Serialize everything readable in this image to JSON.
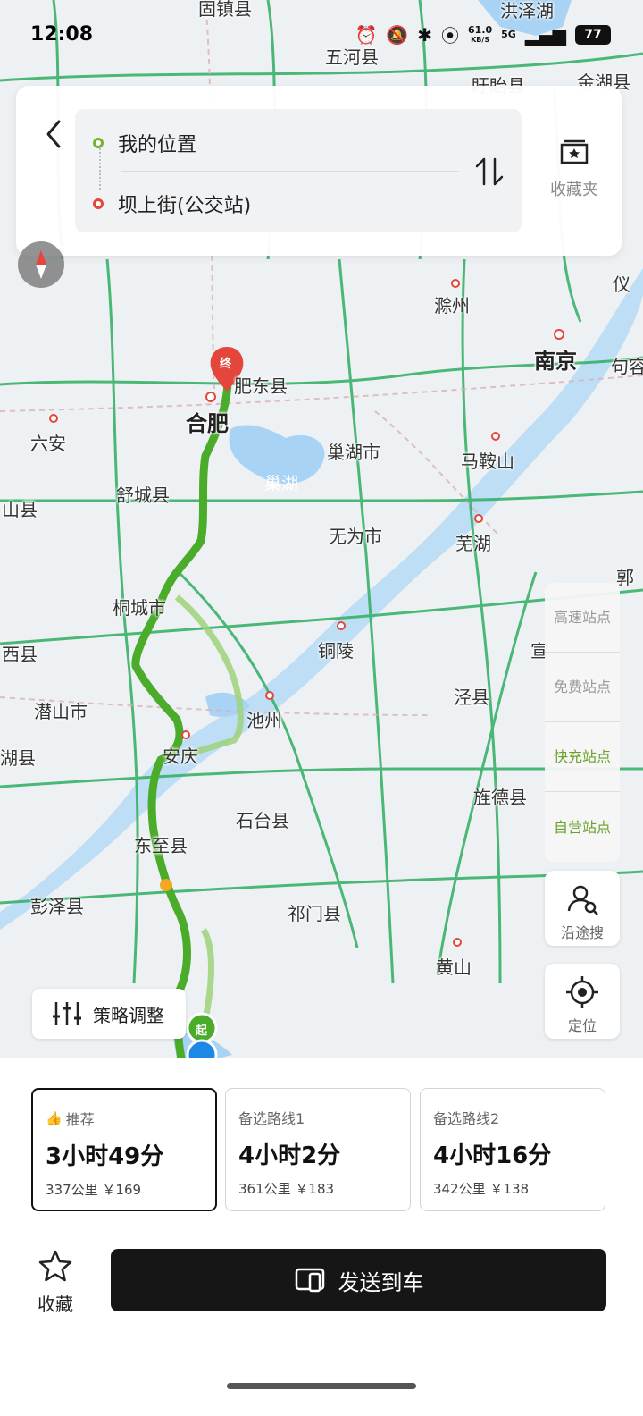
{
  "status": {
    "time": "12:08",
    "net_speed": "61.0",
    "net_unit": "KB/S",
    "net_type": "5G",
    "battery": "77"
  },
  "route_search": {
    "origin": "我的位置",
    "destination": "坝上街(公交站)",
    "favorites_label": "收藏夹"
  },
  "map": {
    "labels": {
      "gu_zhen": "固镇县",
      "hongze_lake": "洪泽湖",
      "wuhe": "五河县",
      "xuyi": "盱眙县",
      "jinhu": "金湖县",
      "chuzhou": "滁州",
      "nanjing": "南京",
      "feidong": "肥东县",
      "hefei": "合肥",
      "liuan": "六安",
      "chaohu_city": "巢湖市",
      "chaohu_lake": "巢湖",
      "maanshan": "马鞍山",
      "shucheng": "舒城县",
      "wuwei": "无为市",
      "wuhu": "芜湖",
      "tongcheng": "桐城市",
      "tongling": "铜陵",
      "qianshan": "潜山市",
      "chizhou": "池州",
      "anqing": "安庆",
      "jingxian": "泾县",
      "jingde": "旌德县",
      "shitai": "石台县",
      "dongzhi": "东至县",
      "pengze": "彭泽县",
      "qimen": "祁门县",
      "huangshan": "黄山",
      "hubei_county": "湖县",
      "xi_county": "西县",
      "shan_county": "山县",
      "xuan": "宣",
      "gu": "郭",
      "ju": "句容",
      "yi": "仪",
      "ding": "定",
      "end_marker": "终",
      "start_marker": "起"
    }
  },
  "side_panel": {
    "highway_stations": "高速站点",
    "free_stations": "免费站点",
    "fast_charge": "快充站点",
    "self_operated": "自营站点",
    "along_search": "沿途搜",
    "locate": "定位"
  },
  "strategy_label": "策略调整",
  "routes": [
    {
      "tag": "推荐",
      "duration": "3小时49分",
      "meta": "337公里 ￥169"
    },
    {
      "tag": "备选路线1",
      "duration": "4小时2分",
      "meta": "361公里 ￥183"
    },
    {
      "tag": "备选路线2",
      "duration": "4小时16分",
      "meta": "342公里 ￥138"
    }
  ],
  "actions": {
    "collect_label": "收藏",
    "send_label": "发送到车"
  },
  "colors": {
    "route_main": "#4bab2a",
    "route_alt": "#9fd27a",
    "road": "#2fae62",
    "water": "#a9d3f4"
  }
}
